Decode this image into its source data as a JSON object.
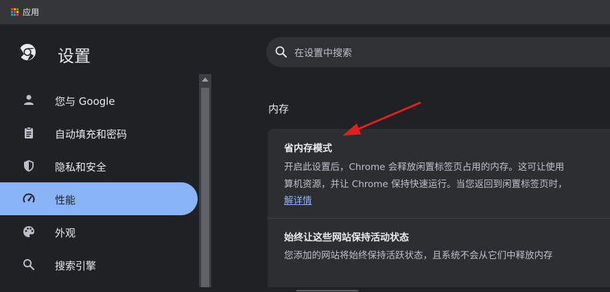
{
  "bookmarks_bar": {
    "apps_label": "应用",
    "apps_colors": [
      "#ea4335",
      "#fbbc04",
      "#34a853",
      "#4285f4",
      "#ea4335",
      "#fbbc04",
      "#34a853",
      "#4285f4",
      "#ea4335"
    ]
  },
  "header": {
    "title": "设置",
    "logo_icon": "chrome-icon"
  },
  "search": {
    "placeholder": "在设置中搜索"
  },
  "sidebar": {
    "items": [
      {
        "label": "您与 Google",
        "icon": "person-icon",
        "active": false
      },
      {
        "label": "自动填充和密码",
        "icon": "clipboard-icon",
        "active": false
      },
      {
        "label": "隐私和安全",
        "icon": "shield-icon",
        "active": false
      },
      {
        "label": "性能",
        "icon": "speedometer-icon",
        "active": true
      },
      {
        "label": "外观",
        "icon": "palette-icon",
        "active": false
      },
      {
        "label": "搜索引擎",
        "icon": "search-icon",
        "active": false
      }
    ]
  },
  "main": {
    "section_title": "内存",
    "memory_saver": {
      "title": "省内存模式",
      "desc_line1": "开启此设置后，Chrome 会释放闲置标签页占用的内存。这可让使用",
      "desc_line2": "算机资源，并让 Chrome 保持快速运行。当您返回到闲置标签页时，",
      "link": "解详情"
    },
    "always_active": {
      "title": "始终让这些网站保持活动状态",
      "desc": "您添加的网站将始终保持活跃状态，且系统不会从它们中释放内存"
    }
  },
  "colors": {
    "accent": "#8ab4f8",
    "annotation_arrow": "#e0201c",
    "background": "#202124"
  }
}
